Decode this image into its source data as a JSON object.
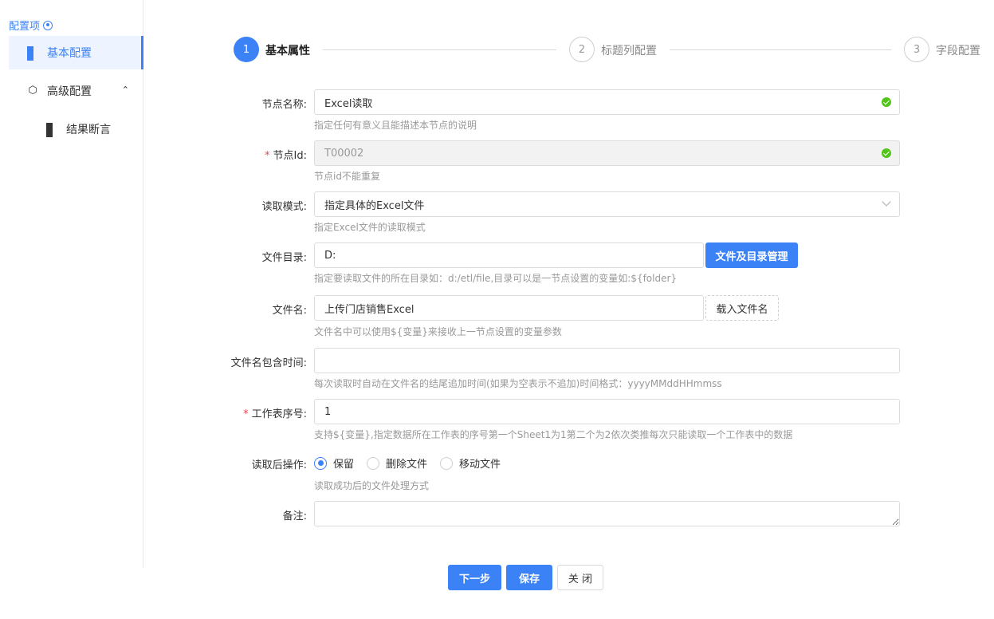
{
  "sidebar": {
    "title": "配置项",
    "items": [
      {
        "label": "基本配置"
      },
      {
        "label": "高级配置"
      },
      {
        "label": "结果断言"
      }
    ]
  },
  "steps": [
    {
      "num": "1",
      "label": "基本属性",
      "state": "active"
    },
    {
      "num": "2",
      "label": "标题列配置",
      "state": "idle"
    },
    {
      "num": "3",
      "label": "字段配置",
      "state": "idle"
    }
  ],
  "form": {
    "node_name": {
      "label": "节点名称:",
      "value": "Excel读取",
      "hint": "指定任何有意义且能描述本节点的说明"
    },
    "node_id": {
      "required_mark": "*",
      "label": "节点Id:",
      "value": "T00002",
      "hint": "节点id不能重复"
    },
    "read_mode": {
      "label": "读取模式:",
      "value": "指定具体的Excel文件",
      "hint": "指定Excel文件的读取模式"
    },
    "file_dir": {
      "label": "文件目录:",
      "value": "D:",
      "button": "文件及目录管理",
      "hint": "指定要读取文件的所在目录如：d:/etl/file,目录可以是一节点设置的变量如:${folder}"
    },
    "file_name": {
      "label": "文件名:",
      "value": "上传门店销售Excel",
      "button": "载入文件名",
      "hint": "文件名中可以使用${变量}来接收上一节点设置的变量参数"
    },
    "file_time": {
      "label": "文件名包含时间:",
      "value": "",
      "hint": "每次读取时自动在文件名的结尾追加时间(如果为空表示不追加)时间格式：yyyyMMddHHmmss"
    },
    "sheet_index": {
      "required_mark": "*",
      "label": "工作表序号:",
      "value": "1",
      "hint": "支持${变量},指定数据所在工作表的序号第一个Sheet1为1第二个为2依次类推每次只能读取一个工作表中的数据"
    },
    "after_read": {
      "label": "读取后操作:",
      "options": [
        "保留",
        "删除文件",
        "移动文件"
      ],
      "selected": "保留",
      "hint": "读取成功后的文件处理方式"
    },
    "remark": {
      "label": "备注:",
      "value": ""
    }
  },
  "footer": {
    "next": "下一步",
    "save": "保存",
    "close": "关 闭"
  },
  "colors": {
    "accent": "#3b82f6",
    "success": "#52c41a",
    "required": "#e5484d"
  }
}
